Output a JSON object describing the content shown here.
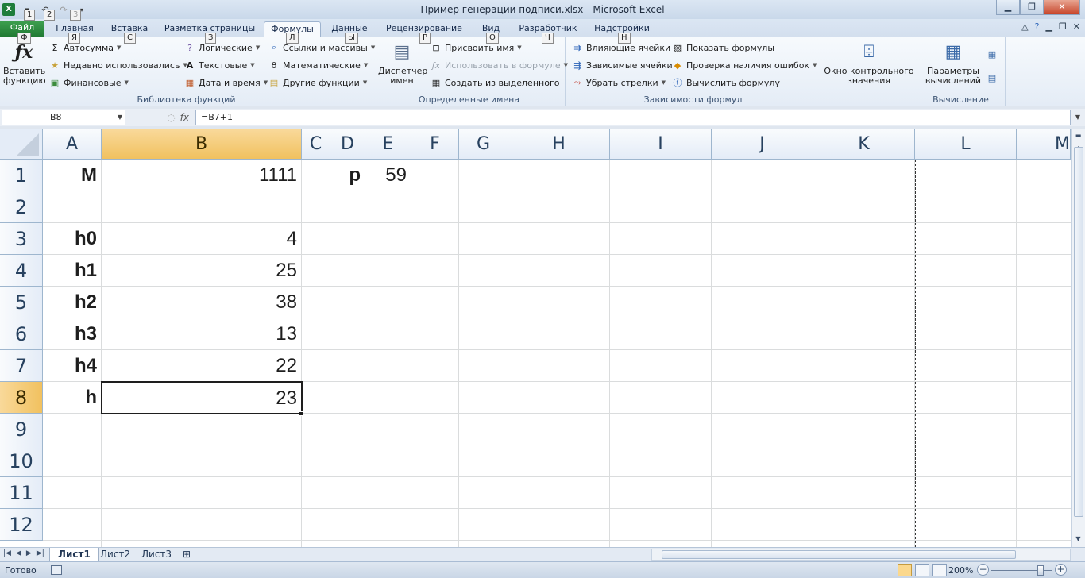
{
  "window": {
    "title": "Пример генерации подписи.xlsx - Microsoft Excel",
    "app_icon": "X",
    "min": "▁",
    "max": "❐",
    "close": "✕"
  },
  "qat_tips": [
    "1",
    "2",
    "3"
  ],
  "tabs": [
    {
      "label": "Файл",
      "tip": "Ф"
    },
    {
      "label": "Главная",
      "tip": "Я"
    },
    {
      "label": "Вставка",
      "tip": "С"
    },
    {
      "label": "Разметка страницы",
      "tip": "З"
    },
    {
      "label": "Формулы",
      "tip": "Л"
    },
    {
      "label": "Данные",
      "tip": "Ы"
    },
    {
      "label": "Рецензирование",
      "tip": "Р"
    },
    {
      "label": "Вид",
      "tip": "О"
    },
    {
      "label": "Разработчик",
      "tip": "Ч"
    },
    {
      "label": "Надстройки",
      "tip": "Н"
    }
  ],
  "ribbon": {
    "insert_function": "Вставить функцию",
    "library": {
      "label": "Библиотека функций",
      "autosum": "Автосумма",
      "recent": "Недавно использовались",
      "financial": "Финансовые",
      "logical": "Логические",
      "text": "Текстовые",
      "datetime": "Дата и время",
      "lookup": "Ссылки и массивы",
      "math": "Математические",
      "other": "Другие функции"
    },
    "names": {
      "label": "Определенные имена",
      "manager": "Диспетчер имен",
      "define": "Присвоить имя",
      "use": "Использовать в формуле",
      "create": "Создать из выделенного"
    },
    "audit": {
      "label": "Зависимости формул",
      "precedents": "Влияющие ячейки",
      "dependents": "Зависимые ячейки",
      "remove_arrows": "Убрать стрелки",
      "show_formulas": "Показать формулы",
      "error_check": "Проверка наличия ошибок",
      "evaluate": "Вычислить формулу",
      "watch": "Окно контрольного значения"
    },
    "calc": {
      "label": "Вычисление",
      "options": "Параметры вычислений"
    }
  },
  "formula_bar": {
    "name_box": "B8",
    "fx": "fx",
    "formula": "=B7+1"
  },
  "columns": [
    "A",
    "B",
    "C",
    "D",
    "E",
    "F",
    "G",
    "H",
    "I",
    "J",
    "K",
    "L",
    "M"
  ],
  "rows": [
    "1",
    "2",
    "3",
    "4",
    "5",
    "6",
    "7",
    "8",
    "9",
    "10",
    "11",
    "12"
  ],
  "cells": {
    "A1": "M",
    "B1": "1111",
    "D1": "p",
    "E1": "59",
    "A3": "h0",
    "B3": "4",
    "A4": "h1",
    "B4": "25",
    "A5": "h2",
    "B5": "38",
    "A6": "h3",
    "B6": "13",
    "A7": "h4",
    "B7": "22",
    "A8": "h",
    "B8": "23"
  },
  "sheets": [
    "Лист1",
    "Лист2",
    "Лист3"
  ],
  "status": {
    "ready": "Готово",
    "zoom": "200%"
  }
}
